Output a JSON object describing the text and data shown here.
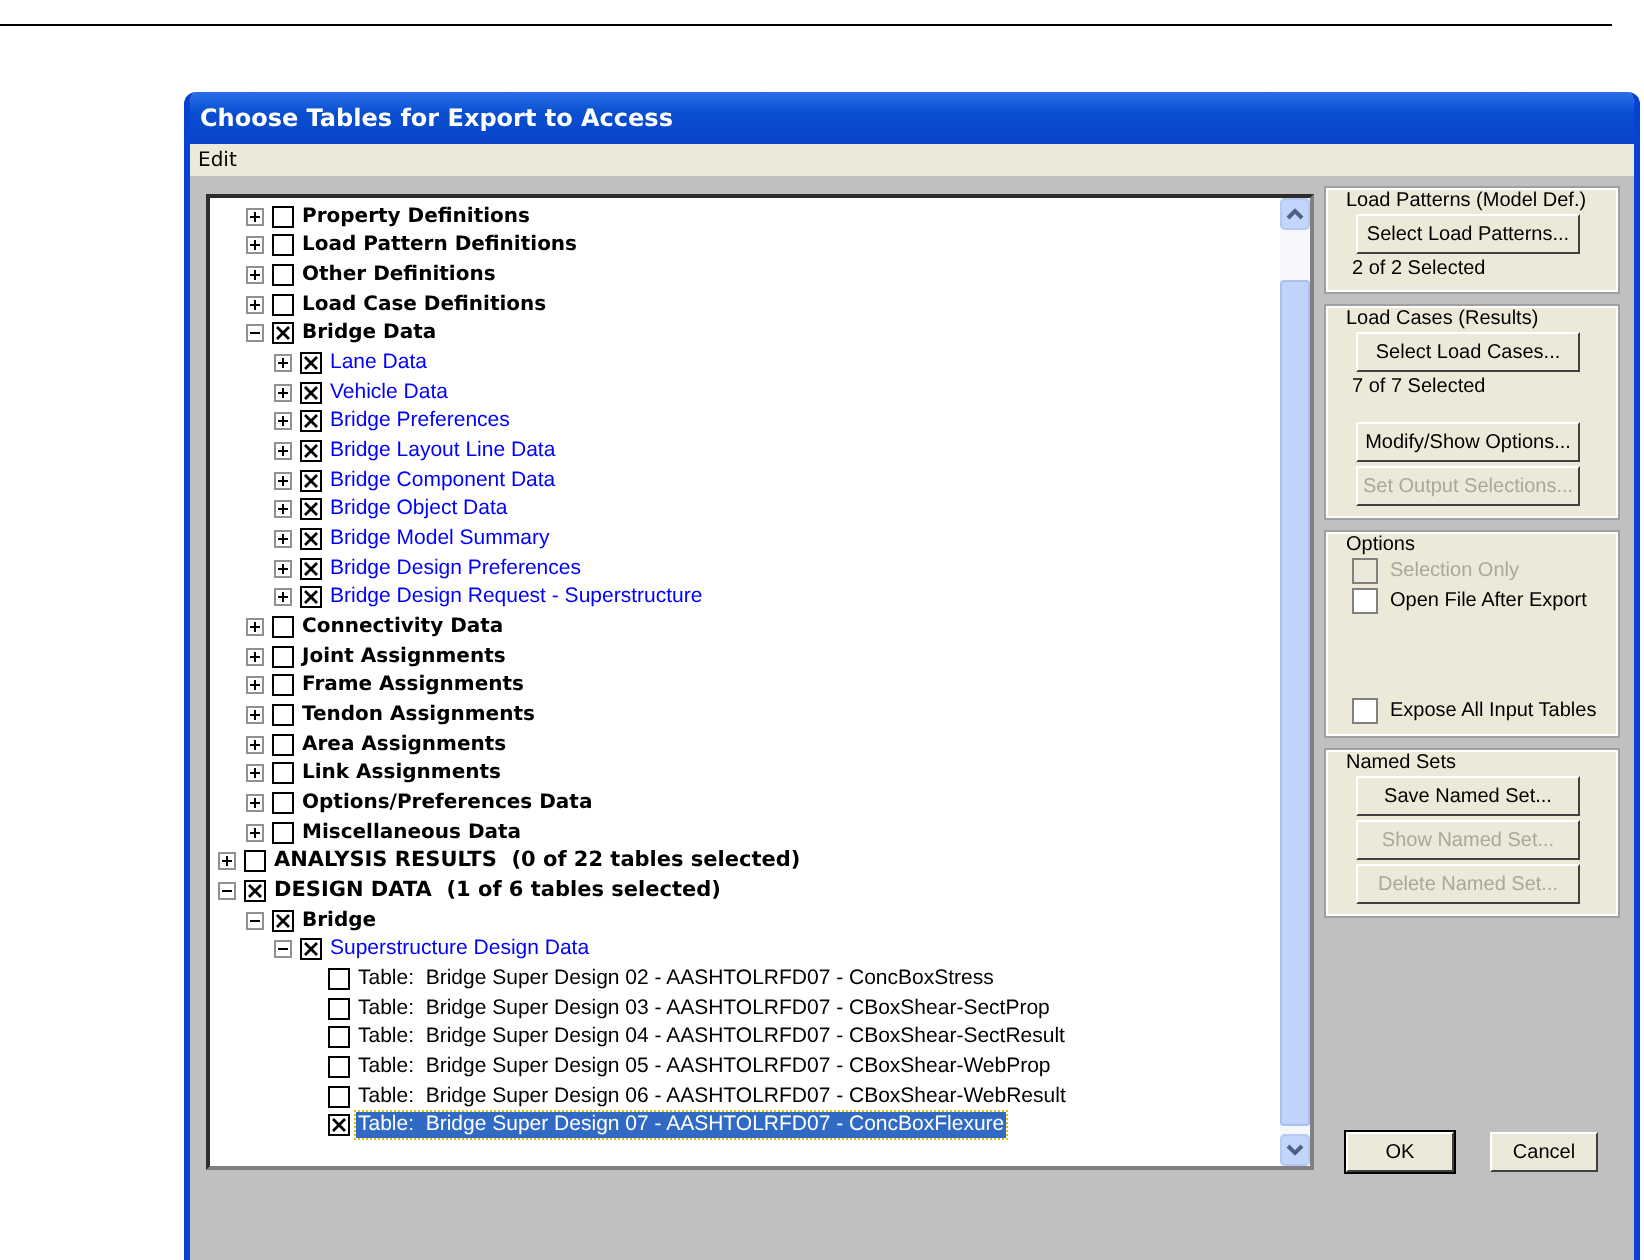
{
  "window": {
    "title": "Choose Tables for Export to Access"
  },
  "menu": [
    "Edit"
  ],
  "tree": {
    "scrolled_branch": [
      {
        "label": "Property Definitions",
        "kind": "group",
        "checked": false,
        "expanded": false
      },
      {
        "label": "Load Pattern Definitions",
        "kind": "group",
        "checked": false,
        "expanded": false
      },
      {
        "label": "Other Definitions",
        "kind": "group",
        "checked": false,
        "expanded": false
      },
      {
        "label": "Load Case Definitions",
        "kind": "group",
        "checked": false,
        "expanded": false
      },
      {
        "label": "Bridge Data",
        "kind": "group",
        "checked": true,
        "expanded": true,
        "children": [
          {
            "label": "Lane Data",
            "kind": "link",
            "checked": true,
            "expanded": false
          },
          {
            "label": "Vehicle Data",
            "kind": "link",
            "checked": true,
            "expanded": false
          },
          {
            "label": "Bridge Preferences",
            "kind": "link",
            "checked": true,
            "expanded": false
          },
          {
            "label": "Bridge Layout Line Data",
            "kind": "link",
            "checked": true,
            "expanded": false
          },
          {
            "label": "Bridge Component Data",
            "kind": "link",
            "checked": true,
            "expanded": false
          },
          {
            "label": "Bridge Object Data",
            "kind": "link",
            "checked": true,
            "expanded": false
          },
          {
            "label": "Bridge Model Summary",
            "kind": "link",
            "checked": true,
            "expanded": false
          },
          {
            "label": "Bridge Design Preferences",
            "kind": "link",
            "checked": true,
            "expanded": false
          },
          {
            "label": "Bridge Design Request - Superstructure",
            "kind": "link",
            "checked": true,
            "expanded": false
          }
        ]
      },
      {
        "label": "Connectivity Data",
        "kind": "group",
        "checked": false,
        "expanded": false
      },
      {
        "label": "Joint Assignments",
        "kind": "group",
        "checked": false,
        "expanded": false
      },
      {
        "label": "Frame Assignments",
        "kind": "group",
        "checked": false,
        "expanded": false
      },
      {
        "label": "Tendon Assignments",
        "kind": "group",
        "checked": false,
        "expanded": false
      },
      {
        "label": "Area Assignments",
        "kind": "group",
        "checked": false,
        "expanded": false
      },
      {
        "label": "Link Assignments",
        "kind": "group",
        "checked": false,
        "expanded": false
      },
      {
        "label": "Options/Preferences Data",
        "kind": "group",
        "checked": false,
        "expanded": false
      },
      {
        "label": "Miscellaneous Data",
        "kind": "group",
        "checked": false,
        "expanded": false
      }
    ],
    "items": [
      {
        "label": "ANALYSIS RESULTS  (0 of 22 tables selected)",
        "kind": "caps",
        "checked": false,
        "expanded": false
      },
      {
        "label": "DESIGN DATA  (1 of 6 tables selected)",
        "kind": "caps",
        "checked": true,
        "expanded": true,
        "children": [
          {
            "label": "Bridge",
            "kind": "group",
            "checked": true,
            "expanded": true,
            "children": [
              {
                "label": "Superstructure Design Data",
                "kind": "link",
                "checked": true,
                "expanded": true,
                "children": [
                  {
                    "label": "Table:  Bridge Super Design 02 - AASHTOLRFD07 - ConcBoxStress",
                    "kind": "table",
                    "checked": false,
                    "selected": false
                  },
                  {
                    "label": "Table:  Bridge Super Design 03 - AASHTOLRFD07 - CBoxShear-SectProp",
                    "kind": "table",
                    "checked": false,
                    "selected": false
                  },
                  {
                    "label": "Table:  Bridge Super Design 04 - AASHTOLRFD07 - CBoxShear-SectResult",
                    "kind": "table",
                    "checked": false,
                    "selected": false
                  },
                  {
                    "label": "Table:  Bridge Super Design 05 - AASHTOLRFD07 - CBoxShear-WebProp",
                    "kind": "table",
                    "checked": false,
                    "selected": false
                  },
                  {
                    "label": "Table:  Bridge Super Design 06 - AASHTOLRFD07 - CBoxShear-WebResult",
                    "kind": "table",
                    "checked": false,
                    "selected": false
                  },
                  {
                    "label": "Table:  Bridge Super Design 07 - AASHTOLRFD07 - ConcBoxFlexure",
                    "kind": "table",
                    "checked": true,
                    "selected": true
                  }
                ]
              }
            ]
          }
        ]
      }
    ]
  },
  "groups": [
    {
      "title": "Load Patterns (Model Def.)",
      "sections": [
        [
          {
            "kind": "button",
            "label": "Select Load Patterns...",
            "disabled": false
          },
          {
            "kind": "text",
            "label": "2 of 2 Selected"
          }
        ]
      ]
    },
    {
      "title": "Load Cases (Results)",
      "sections": [
        [
          {
            "kind": "button",
            "label": "Select Load Cases...",
            "disabled": false
          },
          {
            "kind": "text",
            "label": "7 of 7 Selected"
          }
        ],
        [
          {
            "kind": "button",
            "label": "Modify/Show Options...",
            "disabled": false
          },
          {
            "kind": "button",
            "label": "Set Output Selections...",
            "disabled": true
          }
        ]
      ]
    },
    {
      "title": "Options",
      "sections": [
        [
          {
            "kind": "checkbox",
            "label": "Selection Only",
            "checked": false,
            "disabled": true
          },
          {
            "kind": "checkbox",
            "label": "Open File After Export",
            "checked": false,
            "disabled": false
          }
        ],
        [
          {
            "kind": "checkbox",
            "label": "Expose All Input Tables",
            "checked": false,
            "disabled": false
          }
        ]
      ]
    },
    {
      "title": "Named Sets",
      "sections": [
        [
          {
            "kind": "button",
            "label": "Save Named Set...",
            "disabled": false
          },
          {
            "kind": "button",
            "label": "Show Named Set...",
            "disabled": true
          },
          {
            "kind": "button",
            "label": "Delete Named Set...",
            "disabled": true
          }
        ]
      ]
    }
  ],
  "buttons": [
    {
      "label": "OK",
      "default": true
    },
    {
      "label": "Cancel",
      "default": false
    }
  ]
}
